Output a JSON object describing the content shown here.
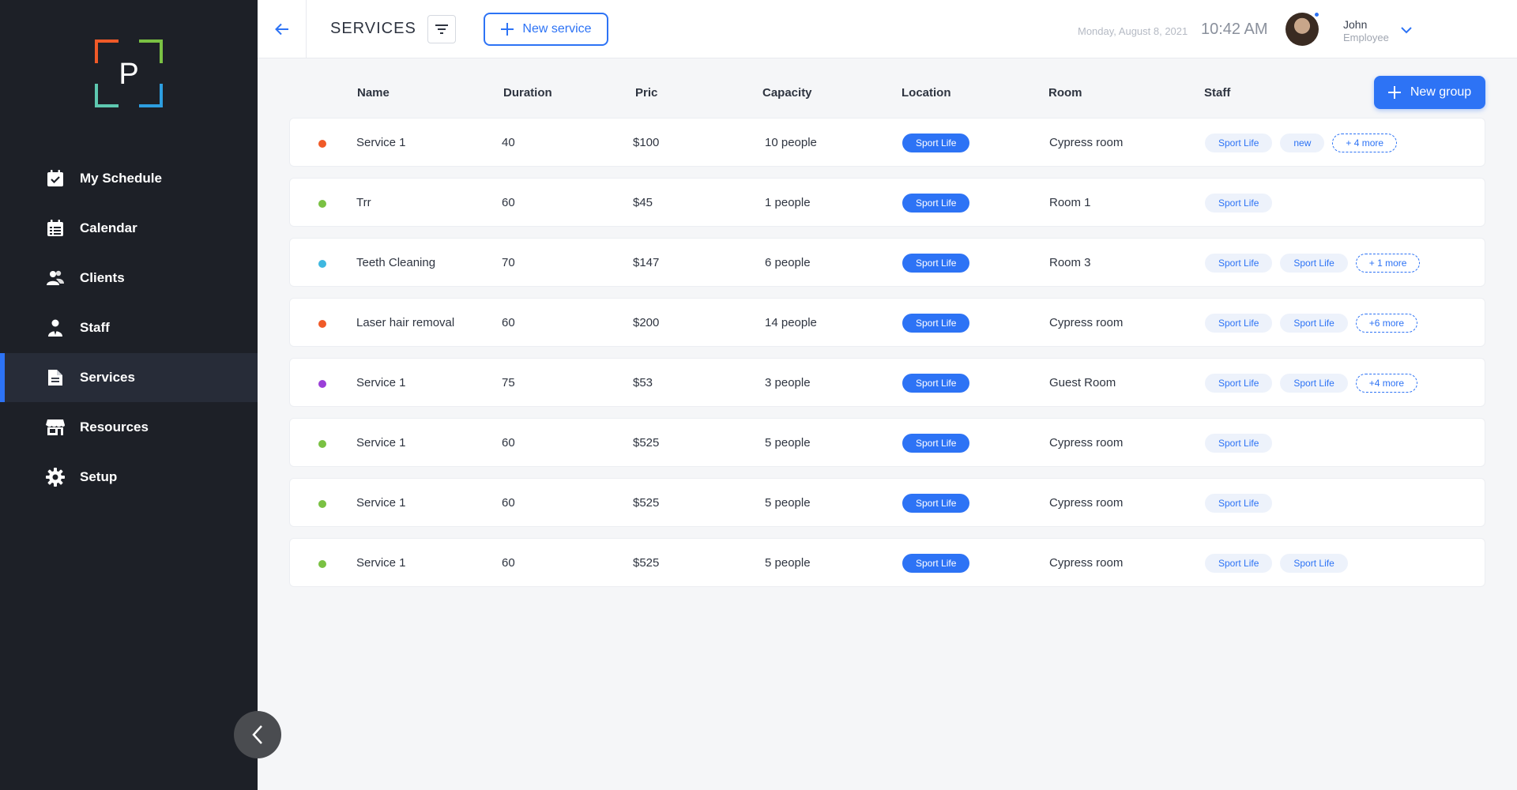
{
  "sidebar": {
    "logo_letter": "P",
    "items": [
      {
        "label": "My Schedule",
        "icon": "calendar-check-icon",
        "active": false
      },
      {
        "label": "Calendar",
        "icon": "calendar-list-icon",
        "active": false
      },
      {
        "label": "Clients",
        "icon": "users-icon",
        "active": false
      },
      {
        "label": "Staff",
        "icon": "staff-icon",
        "active": false
      },
      {
        "label": "Services",
        "icon": "document-icon",
        "active": true
      },
      {
        "label": "Resources",
        "icon": "store-icon",
        "active": false
      },
      {
        "label": "Setup",
        "icon": "gear-icon",
        "active": false
      }
    ]
  },
  "header": {
    "title": "SERVICES",
    "new_service_label": "New service",
    "date": "Monday, August 8, 2021",
    "time": "10:42 AM",
    "user": {
      "name": "John",
      "role": "Employee"
    }
  },
  "table": {
    "columns": [
      "Name",
      "Duration",
      "Pric",
      "Capacity",
      "Location",
      "Room",
      "Staff"
    ],
    "new_group_label": "New group",
    "rows": [
      {
        "color": "#f05a28",
        "name": "Service 1",
        "duration": "40",
        "price": "$100",
        "capacity": "10 people",
        "location": "Sport Life",
        "room": "Cypress room",
        "staff": [
          "Sport Life",
          "new"
        ],
        "more": "+ 4 more"
      },
      {
        "color": "#7ac143",
        "name": "Trr",
        "duration": "60",
        "price": "$45",
        "capacity": "1 people",
        "location": "Sport Life",
        "room": "Room 1",
        "staff": [
          "Sport Life"
        ],
        "more": ""
      },
      {
        "color": "#3fb8e0",
        "name": "Teeth Cleaning",
        "duration": "70",
        "price": "$147",
        "capacity": "6 people",
        "location": "Sport Life",
        "room": "Room 3",
        "staff": [
          "Sport Life",
          "Sport Life"
        ],
        "more": "+ 1 more"
      },
      {
        "color": "#f05a28",
        "name": "Laser hair removal",
        "duration": "60",
        "price": "$200",
        "capacity": "14 people",
        "location": "Sport Life",
        "room": "Cypress room",
        "staff": [
          "Sport Life",
          "Sport Life"
        ],
        "more": "+6 more"
      },
      {
        "color": "#9b3fd8",
        "name": "Service 1",
        "duration": "75",
        "price": "$53",
        "capacity": "3 people",
        "location": "Sport Life",
        "room": "Guest Room",
        "staff": [
          "Sport Life",
          "Sport Life"
        ],
        "more": "+4 more"
      },
      {
        "color": "#7ac143",
        "name": "Service 1",
        "duration": "60",
        "price": "$525",
        "capacity": "5 people",
        "location": "Sport Life",
        "room": "Cypress room",
        "staff": [
          "Sport Life"
        ],
        "more": ""
      },
      {
        "color": "#7ac143",
        "name": "Service 1",
        "duration": "60",
        "price": "$525",
        "capacity": "5 people",
        "location": "Sport Life",
        "room": "Cypress room",
        "staff": [
          "Sport Life"
        ],
        "more": ""
      },
      {
        "color": "#7ac143",
        "name": "Service 1",
        "duration": "60",
        "price": "$525",
        "capacity": "5 people",
        "location": "Sport Life",
        "room": "Cypress room",
        "staff": [
          "Sport Life",
          "Sport Life"
        ],
        "more": ""
      }
    ]
  },
  "colors": {
    "accent": "#2d73f5",
    "sidebar_bg": "#1d2027"
  }
}
